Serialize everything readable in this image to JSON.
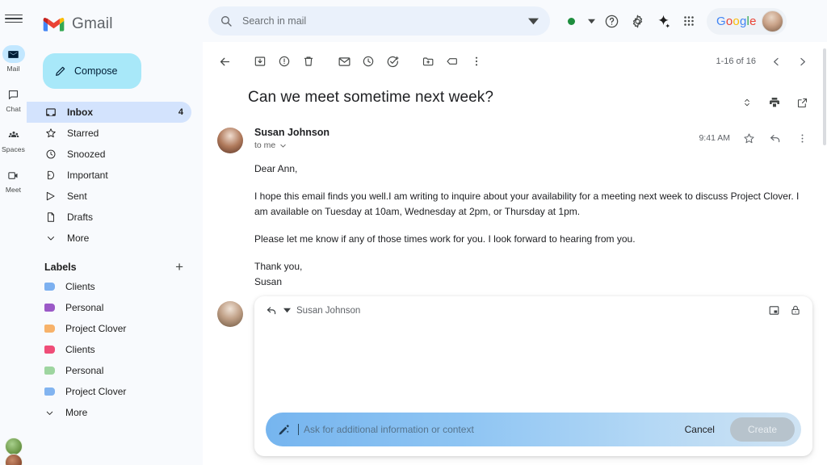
{
  "rail": {
    "menu_icon": "hamburger-menu-icon",
    "items": [
      {
        "label": "Mail",
        "icon": "mail-icon",
        "active": true
      },
      {
        "label": "Chat",
        "icon": "chat-icon",
        "active": false
      },
      {
        "label": "Spaces",
        "icon": "spaces-icon",
        "active": false
      },
      {
        "label": "Meet",
        "icon": "meet-icon",
        "active": false
      }
    ]
  },
  "sidebar": {
    "brand": "Gmail",
    "compose_label": "Compose",
    "nav": [
      {
        "label": "Inbox",
        "icon": "inbox-icon",
        "count": "4",
        "active": true
      },
      {
        "label": "Starred",
        "icon": "star-icon",
        "count": "",
        "active": false
      },
      {
        "label": "Snoozed",
        "icon": "clock-icon",
        "count": "",
        "active": false
      },
      {
        "label": "Important",
        "icon": "important-icon",
        "count": "",
        "active": false
      },
      {
        "label": "Sent",
        "icon": "send-icon",
        "count": "",
        "active": false
      },
      {
        "label": "Drafts",
        "icon": "draft-icon",
        "count": "",
        "active": false
      },
      {
        "label": "More",
        "icon": "chevron-down-icon",
        "count": "",
        "active": false
      }
    ],
    "labels_title": "Labels",
    "labels_add_icon": "plus-icon",
    "labels": [
      {
        "name": "Clients",
        "color": "#7cb0f0"
      },
      {
        "name": "Personal",
        "color": "#9b59c7"
      },
      {
        "name": "Project Clover",
        "color": "#f7b26a"
      },
      {
        "name": "Clients",
        "color": "#ef4d78"
      },
      {
        "name": "Personal",
        "color": "#9ed5a0"
      },
      {
        "name": "Project Clover",
        "color": "#82b4f0"
      },
      {
        "name": "More",
        "color": ""
      }
    ],
    "labels_more": "More"
  },
  "topbar": {
    "search_icon": "search-icon",
    "search_placeholder": "Search in mail",
    "search_value": "",
    "search_options_icon": "chevron-down-icon",
    "status_icon": "status-dot-green",
    "status_caret_icon": "caret-down-icon",
    "help_icon": "help-circle-icon",
    "settings_icon": "gear-icon",
    "gemini_icon": "sparkle-icon",
    "apps_icon": "apps-grid-icon",
    "google_label": "Google",
    "avatar": "user-avatar"
  },
  "mailbar": {
    "back_icon": "back-arrow-icon",
    "archive_icon": "archive-icon",
    "spam_icon": "report-spam-icon",
    "delete_icon": "trash-icon",
    "unread_icon": "mark-unread-icon",
    "snooze_icon": "snooze-clock-icon",
    "tasks_icon": "add-to-tasks-icon",
    "moveto_icon": "move-to-folder-icon",
    "labels_icon": "label-tag-icon",
    "more_icon": "more-vertical-icon",
    "pager_text": "1-16 of 16",
    "prev_icon": "chevron-left-icon",
    "next_icon": "chevron-right-icon"
  },
  "thread": {
    "subject": "Can we meet sometime next week?",
    "expand_icon": "expand-collapse-icon",
    "print_icon": "print-icon",
    "popout_icon": "open-in-new-window-icon",
    "message": {
      "avatar": "sender-avatar",
      "sender": "Susan Johnson",
      "to": "to me",
      "to_caret_icon": "chevron-down-icon",
      "time": "9:41 AM",
      "star_icon": "star-icon",
      "reply_icon": "reply-icon",
      "more_icon": "more-vertical-icon",
      "body": [
        "Dear Ann,",
        "I hope this email finds you well.I am writing to inquire about your availability for a meeting next week to discuss Project Clover. I am available on Tuesday at 10am, Wednesday at 2pm, or Thursday at 1pm.",
        "Please let me know if any of those times work for you. I look forward to hearing from you.",
        "Thank you,",
        "Susan"
      ]
    }
  },
  "reply": {
    "avatar": "user-avatar",
    "reply_icon": "reply-icon",
    "reply_caret_icon": "caret-down-icon",
    "recipient": "Susan Johnson",
    "popout_icon": "pop-out-icon",
    "confidential_icon": "lock-icon",
    "ai": {
      "pen_icon": "magic-pen-icon",
      "placeholder": "Ask for additional information or context",
      "value": "",
      "cancel_label": "Cancel",
      "create_label": "Create"
    }
  },
  "colors": {
    "compose_bg": "#a8e8f9",
    "nav_active_bg": "#d3e3fd",
    "rail_active_bg": "#c2e7ff",
    "ai_bar_start": "#76b5ef",
    "ai_bar_end": "#cfe3f3",
    "create_disabled": "#b7c3cc",
    "status_green": "#1e8e3e"
  }
}
